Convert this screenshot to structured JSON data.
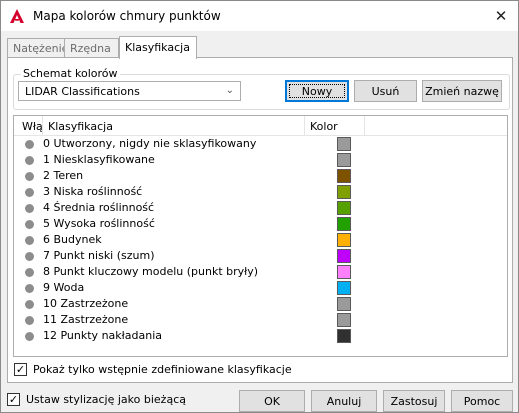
{
  "window": {
    "title": "Mapa kolorów chmury punktów",
    "close_glyph": "✕"
  },
  "tabs": [
    {
      "label": "Natężenie",
      "active": false
    },
    {
      "label": "Rzędna",
      "active": false
    },
    {
      "label": "Klasyfikacja",
      "active": true
    }
  ],
  "scheme": {
    "group_label": "Schemat kolorów",
    "selected": "LIDAR Classifications",
    "buttons": {
      "new": "Nowy",
      "delete": "Usuń",
      "rename": "Zmień nazwę"
    }
  },
  "list": {
    "columns": [
      "Włą",
      "Klasyfikacja",
      "Kolor"
    ],
    "rows": [
      {
        "label": "0 Utworzony, nigdy nie sklasyfikowany",
        "color": "#9a9a9a"
      },
      {
        "label": "1 Niesklasyfikowane",
        "color": "#9a9a9a"
      },
      {
        "label": "2 Teren",
        "color": "#7f5200"
      },
      {
        "label": "3 Niska roślinność",
        "color": "#7fa000"
      },
      {
        "label": "4 Średnia roślinność",
        "color": "#56a000"
      },
      {
        "label": "5 Wysoka roślinność",
        "color": "#22a000"
      },
      {
        "label": "6 Budynek",
        "color": "#ffb000"
      },
      {
        "label": "7 Punkt niski (szum)",
        "color": "#c000ff"
      },
      {
        "label": "8 Punkt kluczowy modelu (punkt bryły)",
        "color": "#ff80ff"
      },
      {
        "label": "9 Woda",
        "color": "#00b0f0"
      },
      {
        "label": "10 Zastrzeżone",
        "color": "#9a9a9a"
      },
      {
        "label": "11 Zastrzeżone",
        "color": "#9a9a9a"
      },
      {
        "label": "12 Punkty nakładania",
        "color": "#303030"
      }
    ]
  },
  "show_predefined": {
    "label": "Pokaż tylko wstępnie zdefiniowane klasyfikacje",
    "checked": true
  },
  "set_current": {
    "label": "Ustaw stylizację jako bieżącą",
    "checked": true
  },
  "footer_buttons": {
    "ok": "OK",
    "cancel": "Anuluj",
    "apply": "Zastosuj",
    "help": "Pomoc"
  },
  "colors": {
    "accent": "#0078d7",
    "app_icon": "#d4002b"
  }
}
